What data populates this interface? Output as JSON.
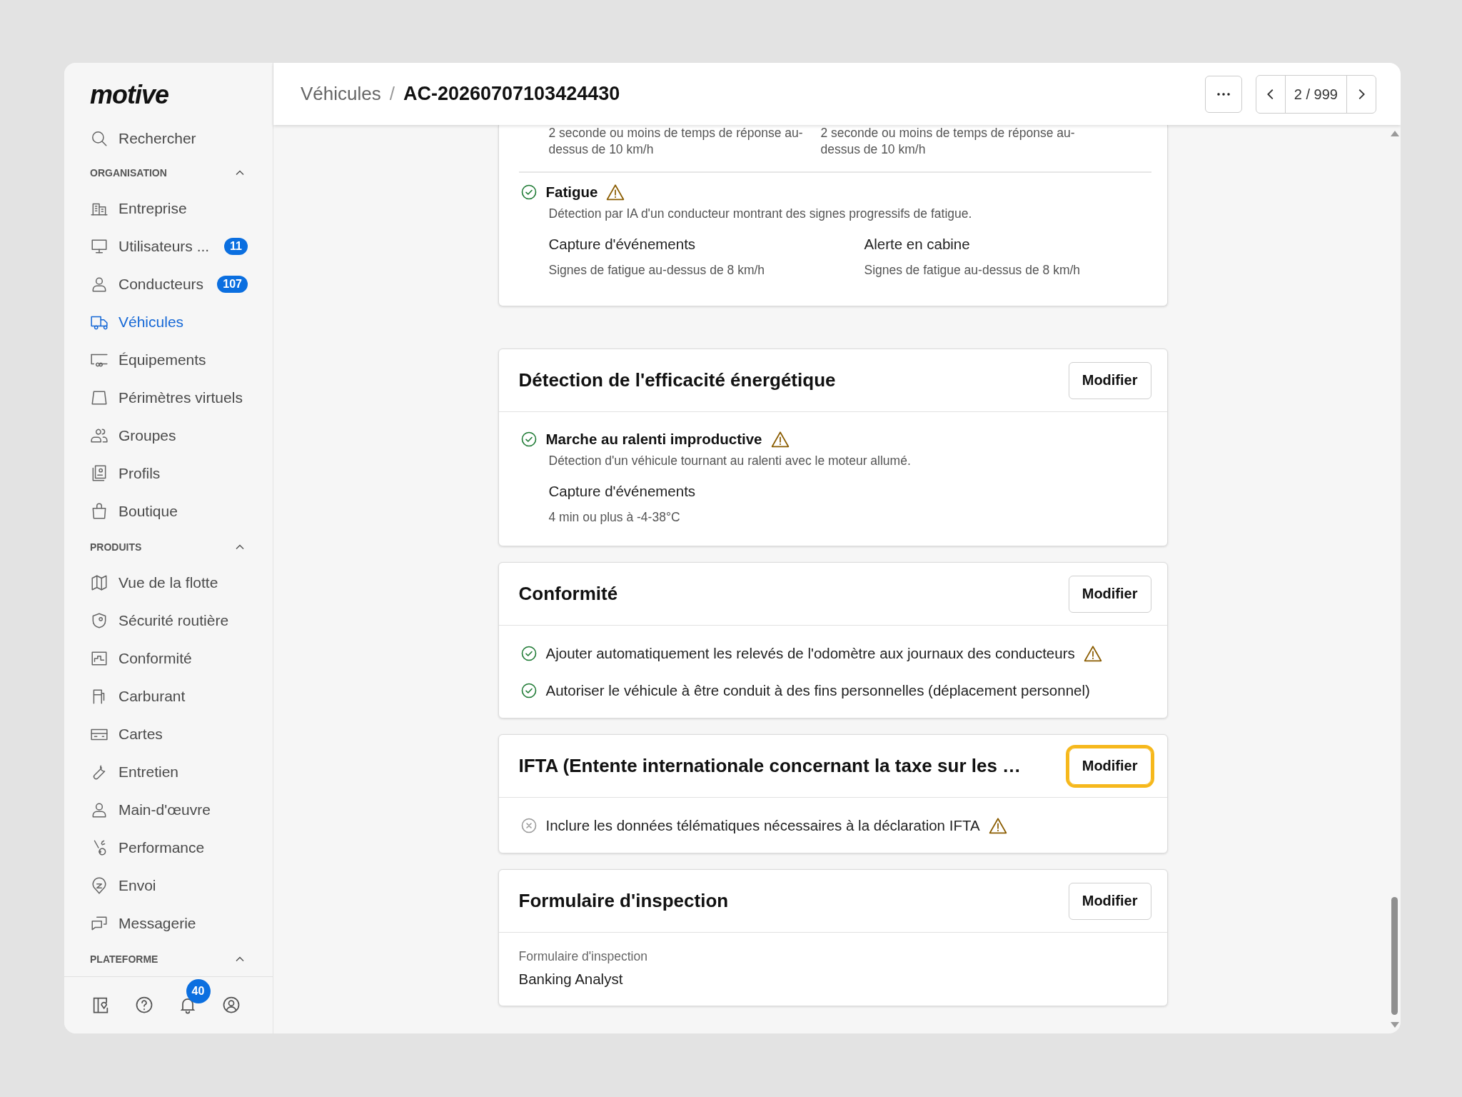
{
  "sidebar": {
    "logo": "motive",
    "search": {
      "label": "Rechercher"
    },
    "sections": [
      {
        "title": "ORGANISATION",
        "expanded": true,
        "items": [
          {
            "label": "Entreprise",
            "selected": false
          },
          {
            "label": "Utilisateurs ...",
            "badge": "11",
            "selected": false
          },
          {
            "label": "Conducteurs",
            "badge": "107",
            "selected": false
          },
          {
            "label": "Véhicules",
            "selected": true
          },
          {
            "label": "Équipements",
            "selected": false
          },
          {
            "label": "Périmètres virtuels",
            "selected": false
          },
          {
            "label": "Groupes",
            "selected": false
          },
          {
            "label": "Profils",
            "selected": false
          },
          {
            "label": "Boutique",
            "selected": false
          }
        ]
      },
      {
        "title": "PRODUITS",
        "expanded": true,
        "items": [
          {
            "label": "Vue de la flotte",
            "selected": false
          },
          {
            "label": "Sécurité routière",
            "selected": false
          },
          {
            "label": "Conformité",
            "selected": false
          },
          {
            "label": "Carburant",
            "selected": false
          },
          {
            "label": "Cartes",
            "selected": false
          },
          {
            "label": "Entretien",
            "selected": false
          },
          {
            "label": "Main-d'œuvre",
            "selected": false
          },
          {
            "label": "Performance",
            "selected": false
          },
          {
            "label": "Envoi",
            "selected": false
          },
          {
            "label": "Messagerie",
            "selected": false
          }
        ]
      },
      {
        "title": "PLATEFORME",
        "expanded": true
      }
    ],
    "footer": {
      "notification_badge": "40"
    }
  },
  "header": {
    "breadcrumb": {
      "parent": "Véhicules",
      "separator": "/",
      "current": "AC-20260707103424430"
    },
    "pager": "2 / 999"
  },
  "cards": [
    {
      "blocks": [
        {
          "kind": "columns",
          "columns": [
            {
              "value": "2 seconde ou moins de temps de réponse au-dessus de 10 km/h"
            },
            {
              "value": "2 seconde ou moins de temps de réponse au-dessus de 10 km/h"
            }
          ]
        },
        {
          "kind": "feature",
          "enabled": true,
          "warning": true,
          "title": "Fatigue",
          "description": "Détection par IA d'un conducteur montrant des signes progressifs de fatigue.",
          "columns": [
            {
              "label": "Capture d'événements",
              "value": "Signes de fatigue au-dessus de 8 km/h"
            },
            {
              "label": "Alerte en cabine",
              "value": "Signes de fatigue au-dessus de 8 km/h"
            }
          ]
        }
      ]
    },
    {
      "title": "Détection de l'efficacité énergétique",
      "button": {
        "label": "Modifier",
        "focused": false
      },
      "blocks": [
        {
          "kind": "feature",
          "enabled": true,
          "warning": true,
          "title": "Marche au ralenti improductive",
          "description": "Détection d'un véhicule tournant au ralenti avec le moteur allumé.",
          "columns": [
            {
              "label": "Capture d'événements",
              "value": "4 min ou plus à -4-38°C"
            }
          ]
        }
      ]
    },
    {
      "title": "Conformité",
      "button": {
        "label": "Modifier",
        "focused": false
      },
      "blocks": [
        {
          "kind": "check",
          "enabled": true,
          "warning": true,
          "text": "Ajouter automatiquement les relevés de l'odomètre aux journaux des conducteurs"
        },
        {
          "kind": "check",
          "enabled": true,
          "warning": false,
          "text": "Autoriser le véhicule à être conduit à des fins personnelles (déplacement personnel)"
        }
      ]
    },
    {
      "title": "IFTA (Entente internationale concernant la taxe sur les …",
      "button": {
        "label": "Modifier",
        "focused": true
      },
      "blocks": [
        {
          "kind": "check",
          "enabled": false,
          "warning": true,
          "text": "Inclure les données télématiques nécessaires à la déclaration IFTA"
        }
      ]
    },
    {
      "title": "Formulaire d'inspection",
      "button": {
        "label": "Modifier",
        "focused": false
      },
      "blocks": [
        {
          "kind": "field",
          "label": "Formulaire d'inspection",
          "value": "Banking Analyst"
        }
      ]
    }
  ]
}
